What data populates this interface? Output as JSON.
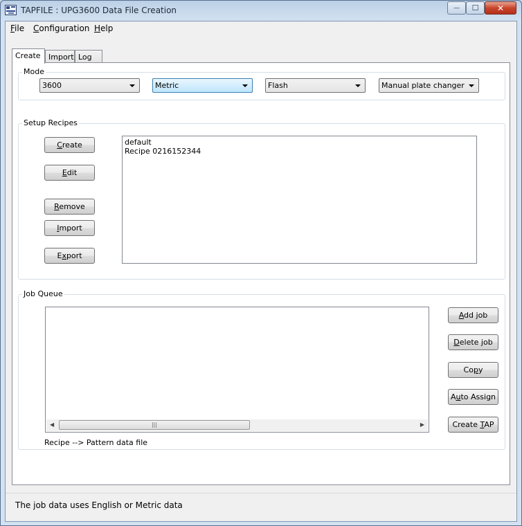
{
  "window": {
    "title": "TAPFILE : UPG3600 Data File Creation",
    "minimize_glyph": "—",
    "maximize_glyph": "☐",
    "close_glyph": "✕"
  },
  "menubar": {
    "items": [
      {
        "label": "File",
        "accel": "F",
        "rest": "ile"
      },
      {
        "label": "Configuration",
        "accel": "C",
        "rest": "onfiguration"
      },
      {
        "label": "Help",
        "accel": "H",
        "rest": "elp"
      }
    ]
  },
  "tabs": {
    "create": "Create",
    "import": "Import",
    "log": "Log"
  },
  "mode": {
    "label": "Mode",
    "model": "3600",
    "units": "Metric",
    "memory": "Flash",
    "plate_changer": "Manual plate changer"
  },
  "setup": {
    "label": "Setup Recipes",
    "buttons": {
      "create": {
        "accel": "C",
        "rest": "reate"
      },
      "edit": {
        "accel": "E",
        "rest": "dit"
      },
      "remove": {
        "accel": "R",
        "rest": "emove"
      },
      "import": {
        "accel": "I",
        "rest": "mport"
      },
      "export": {
        "pre": "E",
        "accel": "x",
        "rest": "port"
      }
    },
    "recipes": [
      "default",
      "Recipe 0216152344"
    ]
  },
  "job_queue": {
    "label": "Job Queue",
    "buttons": {
      "add_job": {
        "pre": "",
        "accel": "A",
        "rest": "dd job"
      },
      "delete_job": {
        "pre": "",
        "accel": "D",
        "rest": "elete job"
      },
      "copy": {
        "pre": "Co",
        "accel": "p",
        "rest": "y"
      },
      "auto_assign": {
        "pre": "A",
        "accel": "u",
        "rest": "to Assign"
      },
      "create_tap": {
        "pre": "Create ",
        "accel": "T",
        "rest": "AP"
      }
    },
    "caption": "Recipe --> Pattern data file",
    "scroll_position": 0.0
  },
  "status": {
    "text": "The job data uses English or Metric data"
  }
}
